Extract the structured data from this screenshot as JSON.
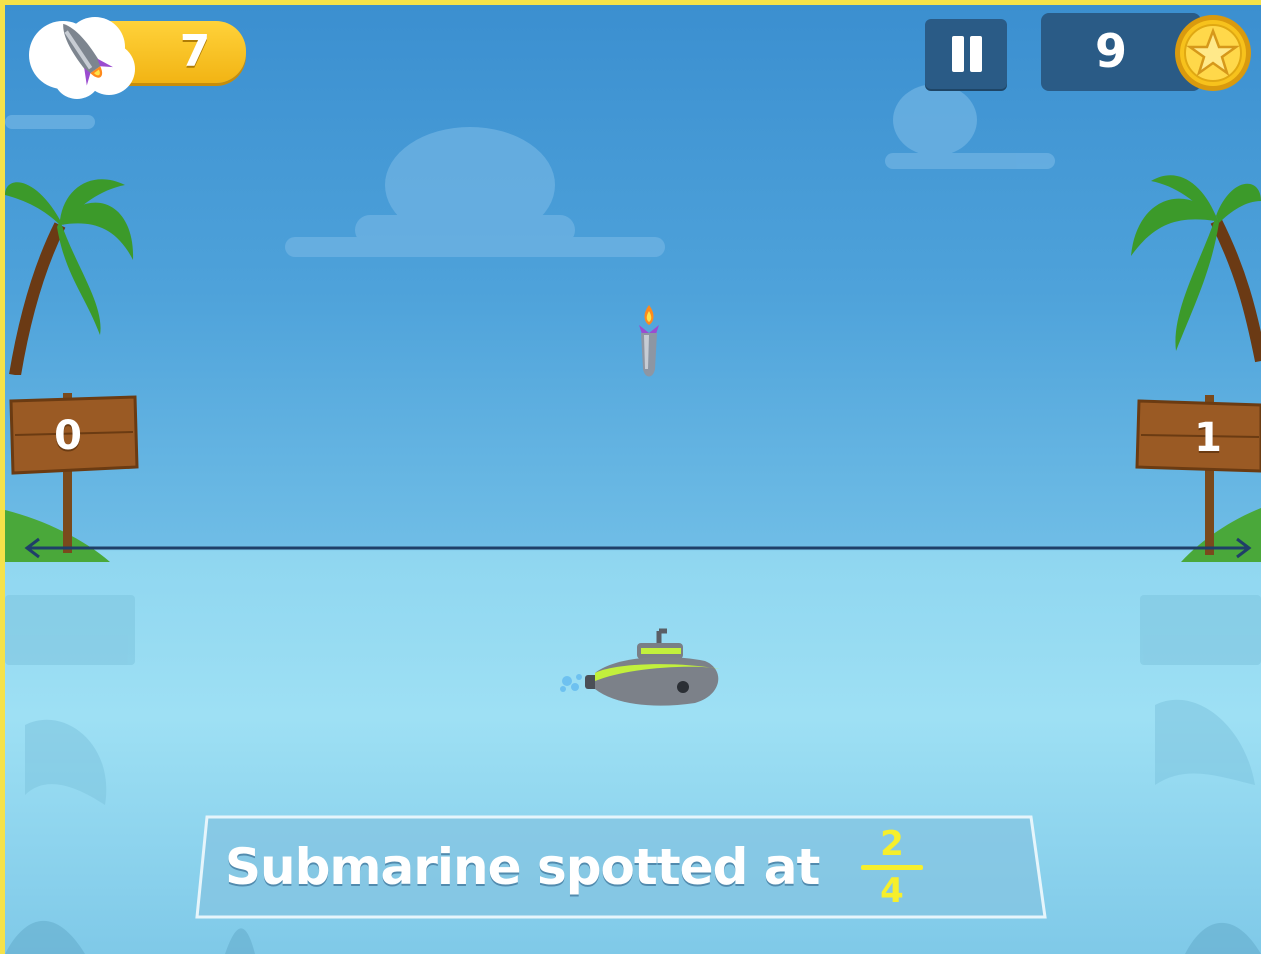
{
  "hud": {
    "rockets_remaining": "7",
    "coins": "9",
    "rocket_icon": "rocket-icon",
    "pause_icon": "pause-icon",
    "coin_icon": "star-coin-icon"
  },
  "number_line": {
    "left_label": "0",
    "right_label": "1"
  },
  "prompt": {
    "text": "Submarine spotted at",
    "fraction_numerator": "2",
    "fraction_denominator": "4"
  },
  "colors": {
    "sky": "#4ea2da",
    "water": "#9ee0f4",
    "hud_panel": "#2a5b86",
    "rocket_pill": "#f2b414",
    "fraction": "#f6ef2c"
  }
}
